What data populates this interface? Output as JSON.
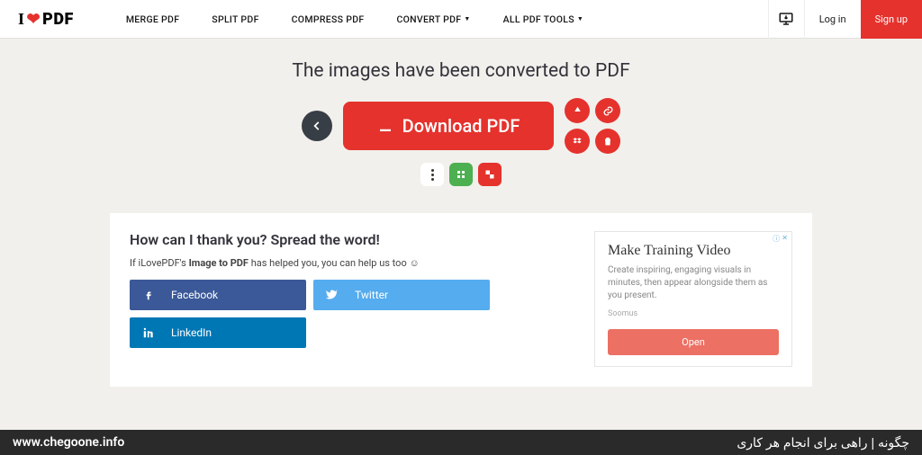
{
  "logo": {
    "i": "I",
    "pdf": "PDF"
  },
  "nav": {
    "merge": "MERGE PDF",
    "split": "SPLIT PDF",
    "compress": "COMPRESS PDF",
    "convert": "CONVERT PDF",
    "all": "ALL PDF TOOLS"
  },
  "header": {
    "login": "Log in",
    "signup": "Sign up"
  },
  "success": {
    "title": "The images have been converted to PDF",
    "download": "Download PDF"
  },
  "thank": {
    "title": "How can I thank you? Spread the word!",
    "pre": "If iLovePDF's ",
    "bold": "Image to PDF",
    "post": " has helped you, you can help us too ☺",
    "facebook": "Facebook",
    "twitter": "Twitter",
    "linkedin": "LinkedIn"
  },
  "ad": {
    "title": "Make Training Video",
    "body": "Create inspiring, engaging visuals in minutes, then appear alongside them as you present.",
    "brand": "Soomus",
    "cta": "Open"
  },
  "footer": {
    "left": "www.chegoone.info",
    "right": "چگونه | راهی برای انجام هر کاری"
  }
}
